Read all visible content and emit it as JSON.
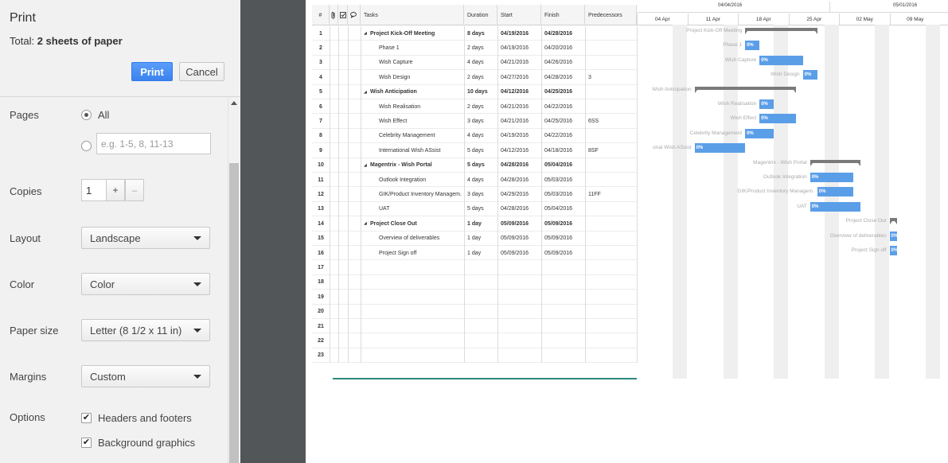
{
  "panel": {
    "title": "Print",
    "total_label": "Total:",
    "total_value": "2 sheets of paper",
    "print_label": "Print",
    "cancel_label": "Cancel",
    "pages": {
      "label": "Pages",
      "all_label": "All",
      "custom_placeholder": "e.g. 1-5, 8, 11-13"
    },
    "copies": {
      "label": "Copies",
      "value": "1",
      "plus": "+",
      "minus": "–"
    },
    "layout": {
      "label": "Layout",
      "value": "Landscape"
    },
    "color": {
      "label": "Color",
      "value": "Color"
    },
    "paper_size": {
      "label": "Paper size",
      "value": "Letter (8 1/2 x 11 in)"
    },
    "margins": {
      "label": "Margins",
      "value": "Custom"
    },
    "options": {
      "label": "Options",
      "headers_footers": "Headers and footers",
      "background_graphics": "Background graphics"
    }
  },
  "grid": {
    "headers": {
      "num": "#",
      "tasks": "Tasks",
      "duration": "Duration",
      "start": "Start",
      "finish": "Finish",
      "predecessors": "Predecessors"
    },
    "rows": [
      {
        "n": "1",
        "task": "Project Kick-Off Meeting",
        "dur": "8 days",
        "start": "04/19/2016",
        "finish": "04/28/2016",
        "pred": "",
        "summary": true
      },
      {
        "n": "2",
        "task": "Phase 1",
        "dur": "2 days",
        "start": "04/19/2016",
        "finish": "04/20/2016",
        "pred": "",
        "summary": false
      },
      {
        "n": "3",
        "task": "Wish Capture",
        "dur": "4 days",
        "start": "04/21/2016",
        "finish": "04/26/2016",
        "pred": "",
        "summary": false
      },
      {
        "n": "4",
        "task": "Wish Design",
        "dur": "2 days",
        "start": "04/27/2016",
        "finish": "04/28/2016",
        "pred": "3",
        "summary": false
      },
      {
        "n": "5",
        "task": "Wish Anticipation",
        "dur": "10 days",
        "start": "04/12/2016",
        "finish": "04/25/2016",
        "pred": "",
        "summary": true
      },
      {
        "n": "6",
        "task": "Wish Realisation",
        "dur": "2 days",
        "start": "04/21/2016",
        "finish": "04/22/2016",
        "pred": "",
        "summary": false
      },
      {
        "n": "7",
        "task": "Wish Effect",
        "dur": "3 days",
        "start": "04/21/2016",
        "finish": "04/25/2016",
        "pred": "6SS",
        "summary": false
      },
      {
        "n": "8",
        "task": "Celebrity Management",
        "dur": "4 days",
        "start": "04/19/2016",
        "finish": "04/22/2016",
        "pred": "",
        "summary": false
      },
      {
        "n": "9",
        "task": "International Wish ASsist",
        "dur": "5 days",
        "start": "04/12/2016",
        "finish": "04/18/2016",
        "pred": "8SF",
        "summary": false
      },
      {
        "n": "10",
        "task": "Magentrix - Wish Portal",
        "dur": "5 days",
        "start": "04/28/2016",
        "finish": "05/04/2016",
        "pred": "",
        "summary": true
      },
      {
        "n": "11",
        "task": "Outlook Integration",
        "dur": "4 days",
        "start": "04/28/2016",
        "finish": "05/03/2016",
        "pred": "",
        "summary": false
      },
      {
        "n": "12",
        "task": "GIK/Product Inventory Managem.",
        "dur": "3 days",
        "start": "04/29/2016",
        "finish": "05/03/2016",
        "pred": "11FF",
        "summary": false
      },
      {
        "n": "13",
        "task": "UAT",
        "dur": "5 days",
        "start": "04/28/2016",
        "finish": "05/04/2016",
        "pred": "",
        "summary": false
      },
      {
        "n": "14",
        "task": "Project Close Out",
        "dur": "1 day",
        "start": "05/09/2016",
        "finish": "05/09/2016",
        "pred": "",
        "summary": true
      },
      {
        "n": "15",
        "task": "Overview of deliverables",
        "dur": "1 day",
        "start": "05/09/2016",
        "finish": "05/09/2016",
        "pred": "",
        "summary": false
      },
      {
        "n": "16",
        "task": "Project Sign off",
        "dur": "1 day",
        "start": "05/09/2016",
        "finish": "05/09/2016",
        "pred": "",
        "summary": false
      },
      {
        "n": "17",
        "task": "",
        "dur": "",
        "start": "",
        "finish": "",
        "pred": "",
        "summary": false
      },
      {
        "n": "18",
        "task": "",
        "dur": "",
        "start": "",
        "finish": "",
        "pred": "",
        "summary": false
      },
      {
        "n": "19",
        "task": "",
        "dur": "",
        "start": "",
        "finish": "",
        "pred": "",
        "summary": false
      },
      {
        "n": "20",
        "task": "",
        "dur": "",
        "start": "",
        "finish": "",
        "pred": "",
        "summary": false
      },
      {
        "n": "21",
        "task": "",
        "dur": "",
        "start": "",
        "finish": "",
        "pred": "",
        "summary": false
      },
      {
        "n": "22",
        "task": "",
        "dur": "",
        "start": "",
        "finish": "",
        "pred": "",
        "summary": false
      },
      {
        "n": "23",
        "task": "",
        "dur": "",
        "start": "",
        "finish": "",
        "pred": "",
        "summary": false
      }
    ]
  },
  "gantt": {
    "months": [
      "04/04/2016",
      "05/01/2016"
    ],
    "weeks": [
      "04 Apr",
      "11 Apr",
      "18 Apr",
      "25 Apr",
      "02 May",
      "09 May"
    ],
    "progress_label": "0%",
    "visible_labels": {
      "1": "Project Kick-Off Meeting",
      "5": "Wish Anticipation",
      "9": "onal Wish ASsist"
    }
  }
}
